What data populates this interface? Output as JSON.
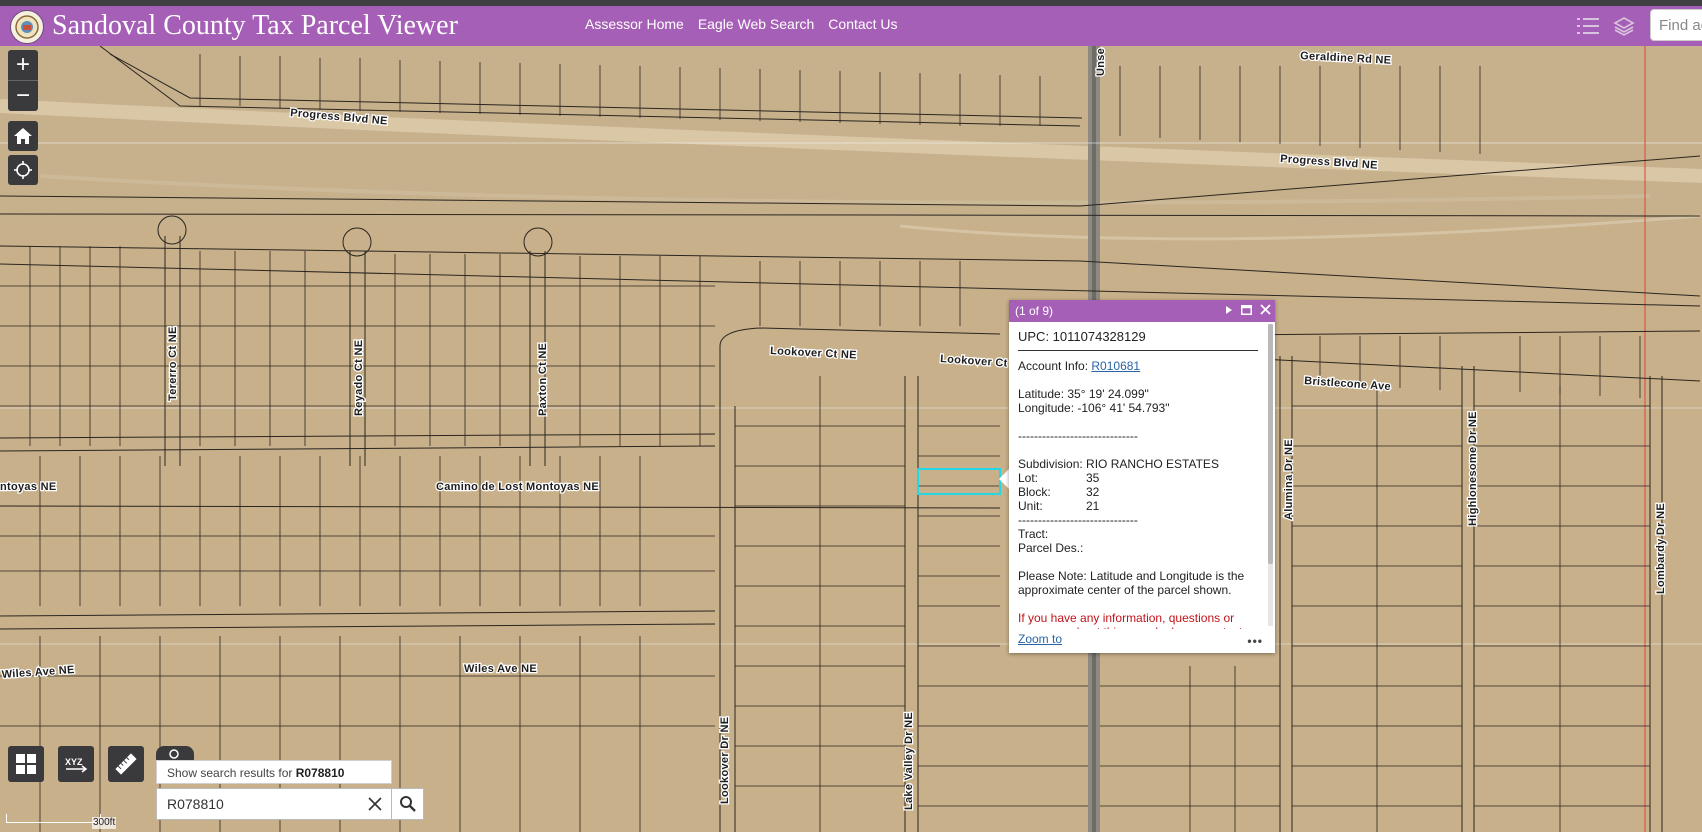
{
  "header": {
    "title": "Sandoval County Tax Parcel Viewer",
    "nav": [
      "Assessor Home",
      "Eagle Web Search",
      "Contact Us"
    ],
    "find_placeholder": "Find ad",
    "accent_color": "#a65fb6"
  },
  "map": {
    "zoom_in": "+",
    "zoom_out": "−",
    "scale_label": "300ft",
    "roads": {
      "geraldine": "Geraldine Rd NE",
      "progress_west": "Progress Blvd NE",
      "progress_east": "Progress Blvd NE",
      "tererro": "Tererro Ct NE",
      "reyado": "Reyado Ct NE",
      "paxton": "Paxton Ct NE",
      "lookover_ct": "Lookover Ct NE",
      "lookover_ct2": "Lookover Ct",
      "bristlecone": "Bristlecone Ave",
      "montoyas_west": "ntoyas NE",
      "camino": "Camino de Lost Montoyas NE",
      "wiles_west": "Wiles Ave NE",
      "wiles_mid": "Wiles Ave NE",
      "lookover_dr": "Lookover Dr NE",
      "lake_valley": "Lake Valley Dr NE",
      "alumina": "Alumina Dr NE",
      "highlonesome": "Highlonesome Dr NE",
      "lombardy": "Lombardy Dr NE",
      "unser": "Unse"
    }
  },
  "toolbar": {
    "icons": [
      "grid-icon",
      "xyz-coordinate-icon",
      "measure-ruler-icon"
    ]
  },
  "search": {
    "suggestion_prefix": "Show search results for ",
    "suggestion_term": "R078810",
    "value": "R078810"
  },
  "popup": {
    "counter": "(1 of 9)",
    "upc": "UPC: 1011074328129",
    "account_label": "Account Info: ",
    "account_link": "R010681",
    "latitude": "Latitude: 35° 19' 24.099\"",
    "longitude": "Longitude: -106° 41' 54.793\"",
    "divider": "------------------------------",
    "subdivision": "Subdivision: RIO RANCHO ESTATES",
    "lot_label": "Lot:",
    "lot_value": "35",
    "block_label": "Block:",
    "block_value": "32",
    "unit_label": "Unit:",
    "unit_value": "21",
    "divider2": "------------------------------",
    "tract": "Tract:",
    "parcel_des": "Parcel Des.:",
    "note": "Please Note: Latitude and Longitude is the approximate center of the parcel shown.",
    "contact": "If you have any information, questions or concerns about this parcel, please contact",
    "zoom_to": "Zoom to",
    "more": "•••"
  }
}
